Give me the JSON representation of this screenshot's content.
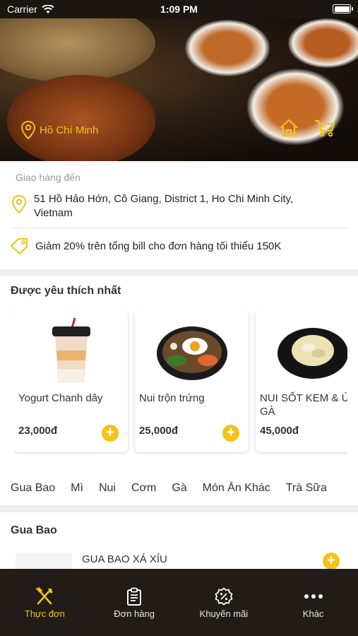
{
  "status_bar": {
    "carrier": "Carrier",
    "time": "1:09 PM"
  },
  "hero": {
    "location": "Hồ Chí Minh",
    "icons": [
      "home-icon",
      "cart-icon"
    ]
  },
  "delivery": {
    "label": "Giao hàng đến",
    "address": "51 Hồ Hảo Hớn, Cô Giang, District 1, Ho Chi Minh City, Vietnam",
    "promo": "Giảm 20% trên tổng bill cho đơn hàng tối thiểu 150K"
  },
  "favorites": {
    "title": "Được yêu thích nhất",
    "items": [
      {
        "name": "Yogurt Chanh dây",
        "price": "23,000đ"
      },
      {
        "name": "Nui trộn trứng",
        "price": "25,000đ"
      },
      {
        "name": "NUI SỐT KEM & ỨC GÀ",
        "price": "45,000đ"
      }
    ],
    "add_symbol": "+"
  },
  "categories": [
    "Gua Bao",
    "Mì",
    "Nui",
    "Cơm",
    "Gà",
    "Món Ăn Khác",
    "Trà Sữa"
  ],
  "section": {
    "title": "Gua Bao",
    "items": [
      {
        "name": "GUA BAO XÁ XÍU"
      }
    ]
  },
  "tabs": [
    {
      "label": "Thực đơn",
      "icon": "fork-knife-icon",
      "active": true
    },
    {
      "label": "Đơn hàng",
      "icon": "clipboard-icon",
      "active": false
    },
    {
      "label": "Khuyến mãi",
      "icon": "percent-badge-icon",
      "active": false
    },
    {
      "label": "Khác",
      "icon": "more-dots-icon",
      "active": false
    }
  ],
  "colors": {
    "accent": "#f4c21a",
    "tabbar": "#211c17",
    "background": "#efefef"
  }
}
